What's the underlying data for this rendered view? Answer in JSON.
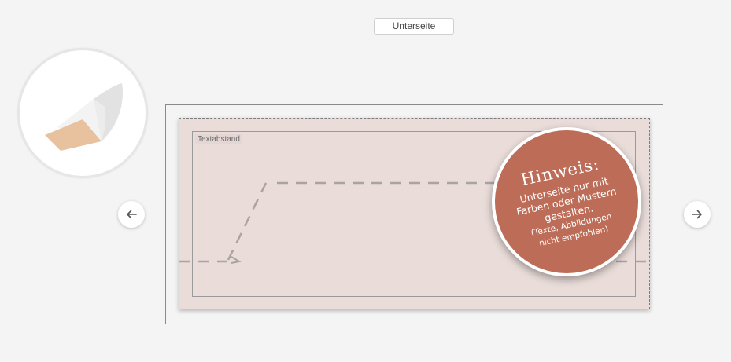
{
  "side_selector": {
    "label": "Unterseite"
  },
  "preview": {
    "icon": "bag-bottom-icon"
  },
  "navigation": {
    "prev_icon": "arrow-left-icon",
    "next_icon": "arrow-right-icon"
  },
  "canvas": {
    "text_area_label": "Textabstand",
    "background_color": "#e9dcd9"
  },
  "notice": {
    "title": "Hinweis:",
    "line1": "Unterseite nur mit",
    "line2": "Farben oder Mustern",
    "line3": "gestalten.",
    "line4": "(Texte, Abbildungen",
    "line5": "nicht empfohlen)",
    "color": "#bd6c58"
  }
}
